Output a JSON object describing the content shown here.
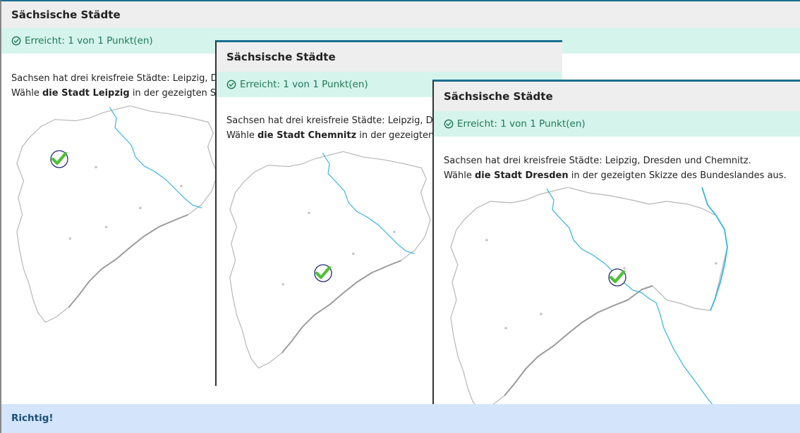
{
  "panels": [
    {
      "title": "Sächsische Städte",
      "status": "Erreicht: 1 von 1 Punkt(en)",
      "line1": "Sachsen hat drei kreisfreie Städte: Leipzig, Dres",
      "line2_pre": "Wähle ",
      "line2_bold": "die Stadt Leipzig",
      "line2_post": " in der gezeigten Skizz"
    },
    {
      "title": "Sächsische Städte",
      "status": "Erreicht: 1 von 1 Punkt(en)",
      "line1": "Sachsen hat drei kreisfreie Städte: Leipzig, Dres",
      "line2_pre": "Wähle ",
      "line2_bold": "die Stadt Chemnitz",
      "line2_post": " in der gezeigten Sk"
    },
    {
      "title": "Sächsische Städte",
      "status": "Erreicht: 1 von 1 Punkt(en)",
      "line1": "Sachsen hat drei kreisfreie Städte: Leipzig, Dresden und Chemnitz.",
      "line2_pre": "Wähle ",
      "line2_bold": "die Stadt Dresden",
      "line2_post": " in der gezeigten Skizze des Bundeslandes aus."
    }
  ],
  "feedback": "Richtig!",
  "colors": {
    "accent": "#1b6e8f",
    "success_bg": "#d5f4ec",
    "success_text": "#1f7a55",
    "feedback_bg": "#d3e4fb",
    "river": "#33b5e0",
    "border_line": "#b5b5b5",
    "check_green": "#4cc133"
  },
  "icons": [
    "check-circle-icon",
    "map-check-marker-icon"
  ]
}
